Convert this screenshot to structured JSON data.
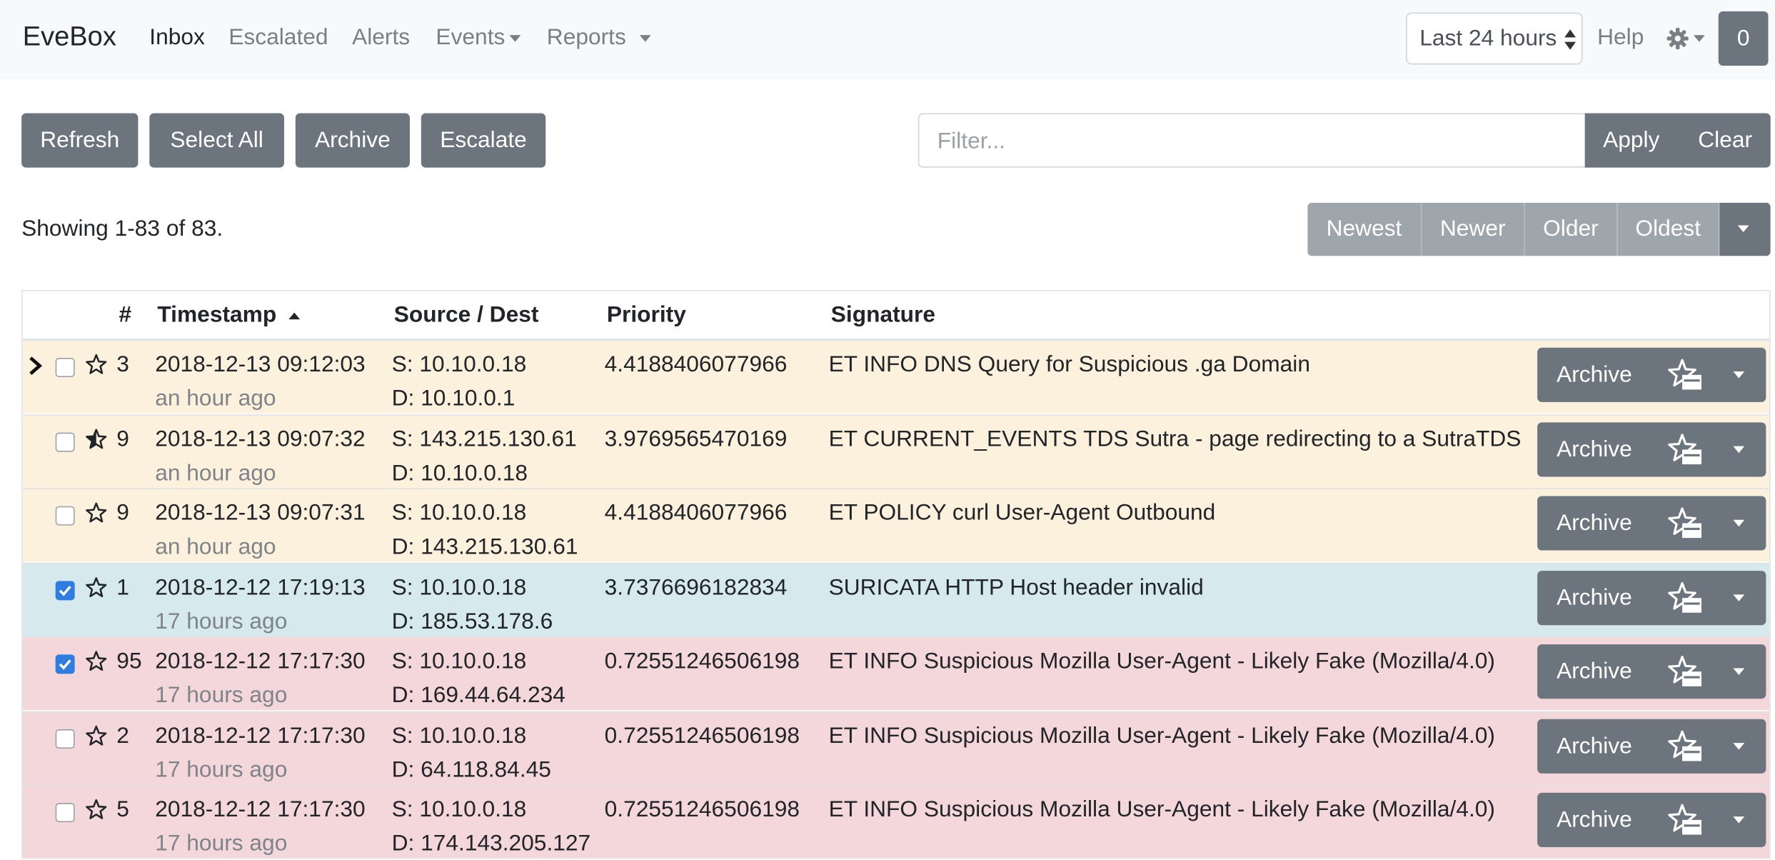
{
  "app": {
    "brand": "EveBox"
  },
  "nav": {
    "inbox": "Inbox",
    "escalated": "Escalated",
    "alerts": "Alerts",
    "events": "Events",
    "reports": "Reports",
    "time_range": "Last 24 hours",
    "help": "Help",
    "counter": "0"
  },
  "toolbar": {
    "refresh": "Refresh",
    "select_all": "Select All",
    "archive": "Archive",
    "escalate": "Escalate",
    "filter_placeholder": "Filter...",
    "apply": "Apply",
    "clear": "Clear"
  },
  "pagination": {
    "showing": "Showing 1-83 of 83.",
    "newest": "Newest",
    "newer": "Newer",
    "older": "Older",
    "oldest": "Oldest"
  },
  "table": {
    "columns": {
      "count": "#",
      "timestamp": "Timestamp",
      "source_dest": "Source / Dest",
      "priority": "Priority",
      "signature": "Signature"
    },
    "sort_indicator": "ascending",
    "row_action_label": "Archive",
    "rows": [
      {
        "count": "3",
        "timestamp": "2018-12-13 09:12:03",
        "ago": "an hour ago",
        "src": "S: 10.10.0.18",
        "dst": "D: 10.10.0.1",
        "priority": "4.4188406077966",
        "signature": "ET INFO DNS Query for Suspicious .ga Domain",
        "checked": false,
        "starred": "empty",
        "expanded_marker": true,
        "bg": "#fcf1dc"
      },
      {
        "count": "9",
        "timestamp": "2018-12-13 09:07:32",
        "ago": "an hour ago",
        "src": "S: 143.215.130.61",
        "dst": "D: 10.10.0.18",
        "priority": "3.9769565470169",
        "signature": "ET CURRENT_EVENTS TDS Sutra - page redirecting to a SutraTDS",
        "checked": false,
        "starred": "half",
        "expanded_marker": false,
        "bg": "#fcf1dc"
      },
      {
        "count": "9",
        "timestamp": "2018-12-13 09:07:31",
        "ago": "an hour ago",
        "src": "S: 10.10.0.18",
        "dst": "D: 143.215.130.61",
        "priority": "4.4188406077966",
        "signature": "ET POLICY curl User-Agent Outbound",
        "checked": false,
        "starred": "empty",
        "expanded_marker": false,
        "bg": "#fcf1dc"
      },
      {
        "count": "1",
        "timestamp": "2018-12-12 17:19:13",
        "ago": "17 hours ago",
        "src": "S: 10.10.0.18",
        "dst": "D: 185.53.178.6",
        "priority": "3.7376696182834",
        "signature": "SURICATA HTTP Host header invalid",
        "checked": true,
        "starred": "empty",
        "expanded_marker": false,
        "bg": "#d6e9ed"
      },
      {
        "count": "95",
        "timestamp": "2018-12-12 17:17:30",
        "ago": "17 hours ago",
        "src": "S: 10.10.0.18",
        "dst": "D: 169.44.64.234",
        "priority": "0.72551246506198",
        "signature": "ET INFO Suspicious Mozilla User-Agent - Likely Fake (Mozilla/4.0)",
        "checked": true,
        "starred": "empty",
        "expanded_marker": false,
        "bg": "#f4d7da"
      },
      {
        "count": "2",
        "timestamp": "2018-12-12 17:17:30",
        "ago": "17 hours ago",
        "src": "S: 10.10.0.18",
        "dst": "D: 64.118.84.45",
        "priority": "0.72551246506198",
        "signature": "ET INFO Suspicious Mozilla User-Agent - Likely Fake (Mozilla/4.0)",
        "checked": false,
        "starred": "empty",
        "expanded_marker": false,
        "bg": "#f4d7da"
      },
      {
        "count": "5",
        "timestamp": "2018-12-12 17:17:30",
        "ago": "17 hours ago",
        "src": "S: 10.10.0.18",
        "dst": "D: 174.143.205.127",
        "priority": "0.72551246506198",
        "signature": "ET INFO Suspicious Mozilla User-Agent - Likely Fake (Mozilla/4.0)",
        "checked": false,
        "starred": "empty",
        "expanded_marker": false,
        "bg": "#f4d7da"
      }
    ]
  },
  "colors": {
    "button": "#6c757d",
    "navbar": "#f8f9fa",
    "checkbox_on": "#2f7de1"
  },
  "icons": {
    "settings": "gear-icon",
    "row_star": "star-icon",
    "row_escalate": "star-archive-icon",
    "expand": "chevron-right-icon"
  }
}
